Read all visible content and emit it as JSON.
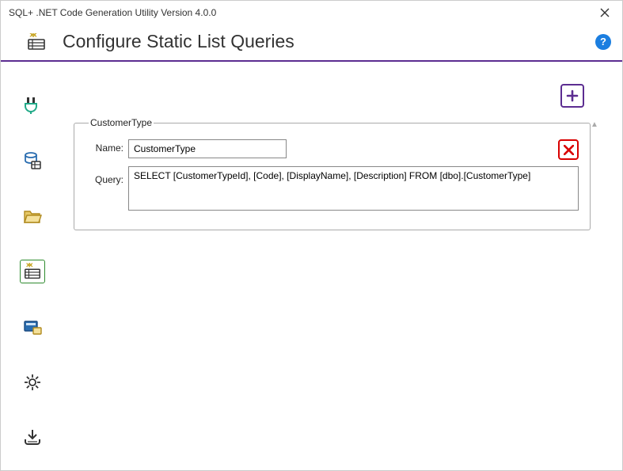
{
  "window": {
    "title": "SQL+ .NET Code Generation Utility Version 4.0.0"
  },
  "header": {
    "title": "Configure Static List Queries"
  },
  "sidebar": {
    "items": [
      {
        "name": "connection-icon"
      },
      {
        "name": "database-schema-icon"
      },
      {
        "name": "folder-icon"
      },
      {
        "name": "static-list-icon"
      },
      {
        "name": "options-icon"
      },
      {
        "name": "settings-icon"
      },
      {
        "name": "generate-icon"
      }
    ]
  },
  "actions": {
    "add_tooltip": "Add",
    "help_label": "?"
  },
  "queries": [
    {
      "legend": "CustomerType",
      "name_label": "Name:",
      "name_value": "CustomerType",
      "query_label": "Query:",
      "query_value": "SELECT [CustomerTypeId], [Code], [DisplayName], [Description] FROM [dbo].[CustomerType]"
    }
  ]
}
